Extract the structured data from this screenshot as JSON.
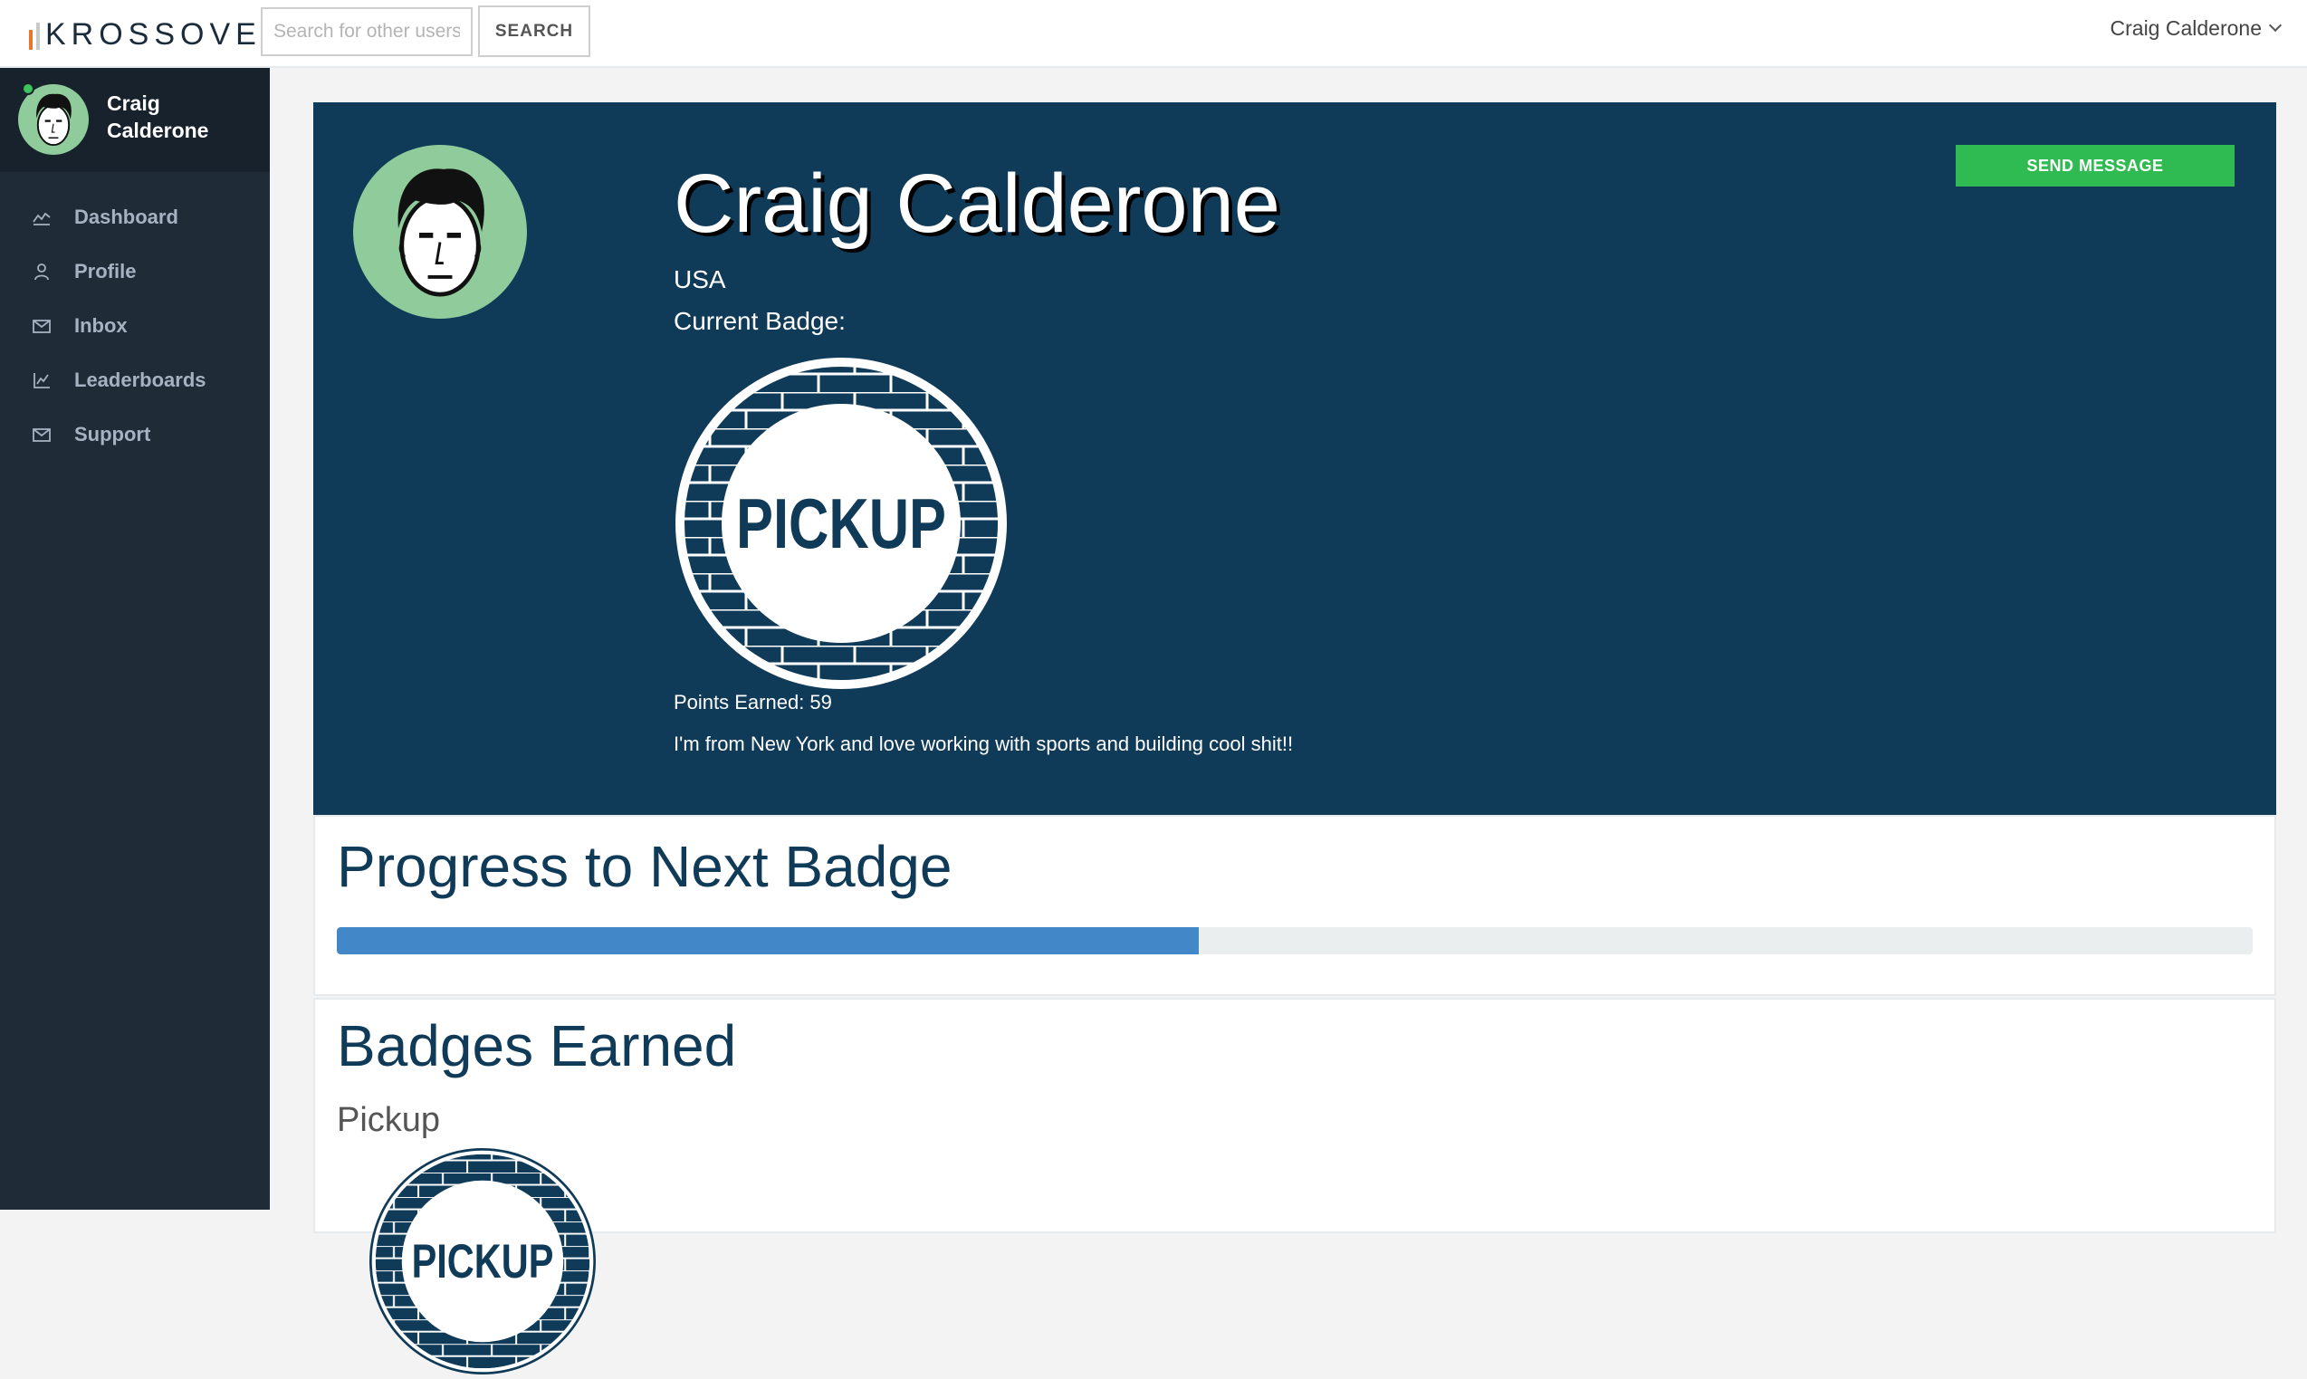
{
  "app": {
    "logo_text": "KROSSOVER",
    "brand_color": "#0f3a58",
    "accent_color": "#2fbb51"
  },
  "topbar": {
    "search_placeholder": "Search for other users",
    "search_button": "SEARCH",
    "user_name": "Craig Calderone",
    "user_menu_icon": "chevron-down-icon"
  },
  "sidebar": {
    "user_name": "Craig Calderone",
    "status": "online",
    "items": [
      {
        "label": "Dashboard",
        "icon": "line-chart-icon"
      },
      {
        "label": "Profile",
        "icon": "user-icon"
      },
      {
        "label": "Inbox",
        "icon": "envelope-icon"
      },
      {
        "label": "Leaderboards",
        "icon": "bar-chart-icon"
      },
      {
        "label": "Support",
        "icon": "envelope-icon"
      }
    ]
  },
  "profile": {
    "name": "Craig Calderone",
    "country": "USA",
    "badge_label": "Current Badge:",
    "badge_text": "PICKUP",
    "points_label": "Points Earned: 59",
    "points": 59,
    "bio": "I'm from New York and love working with sports and building cool shit!!",
    "send_message": "SEND MESSAGE"
  },
  "progress": {
    "title": "Progress to Next Badge",
    "fraction": 0.45
  },
  "badges": {
    "title": "Badges Earned",
    "items": [
      {
        "name": "Pickup",
        "badge_text": "PICKUP"
      }
    ]
  }
}
